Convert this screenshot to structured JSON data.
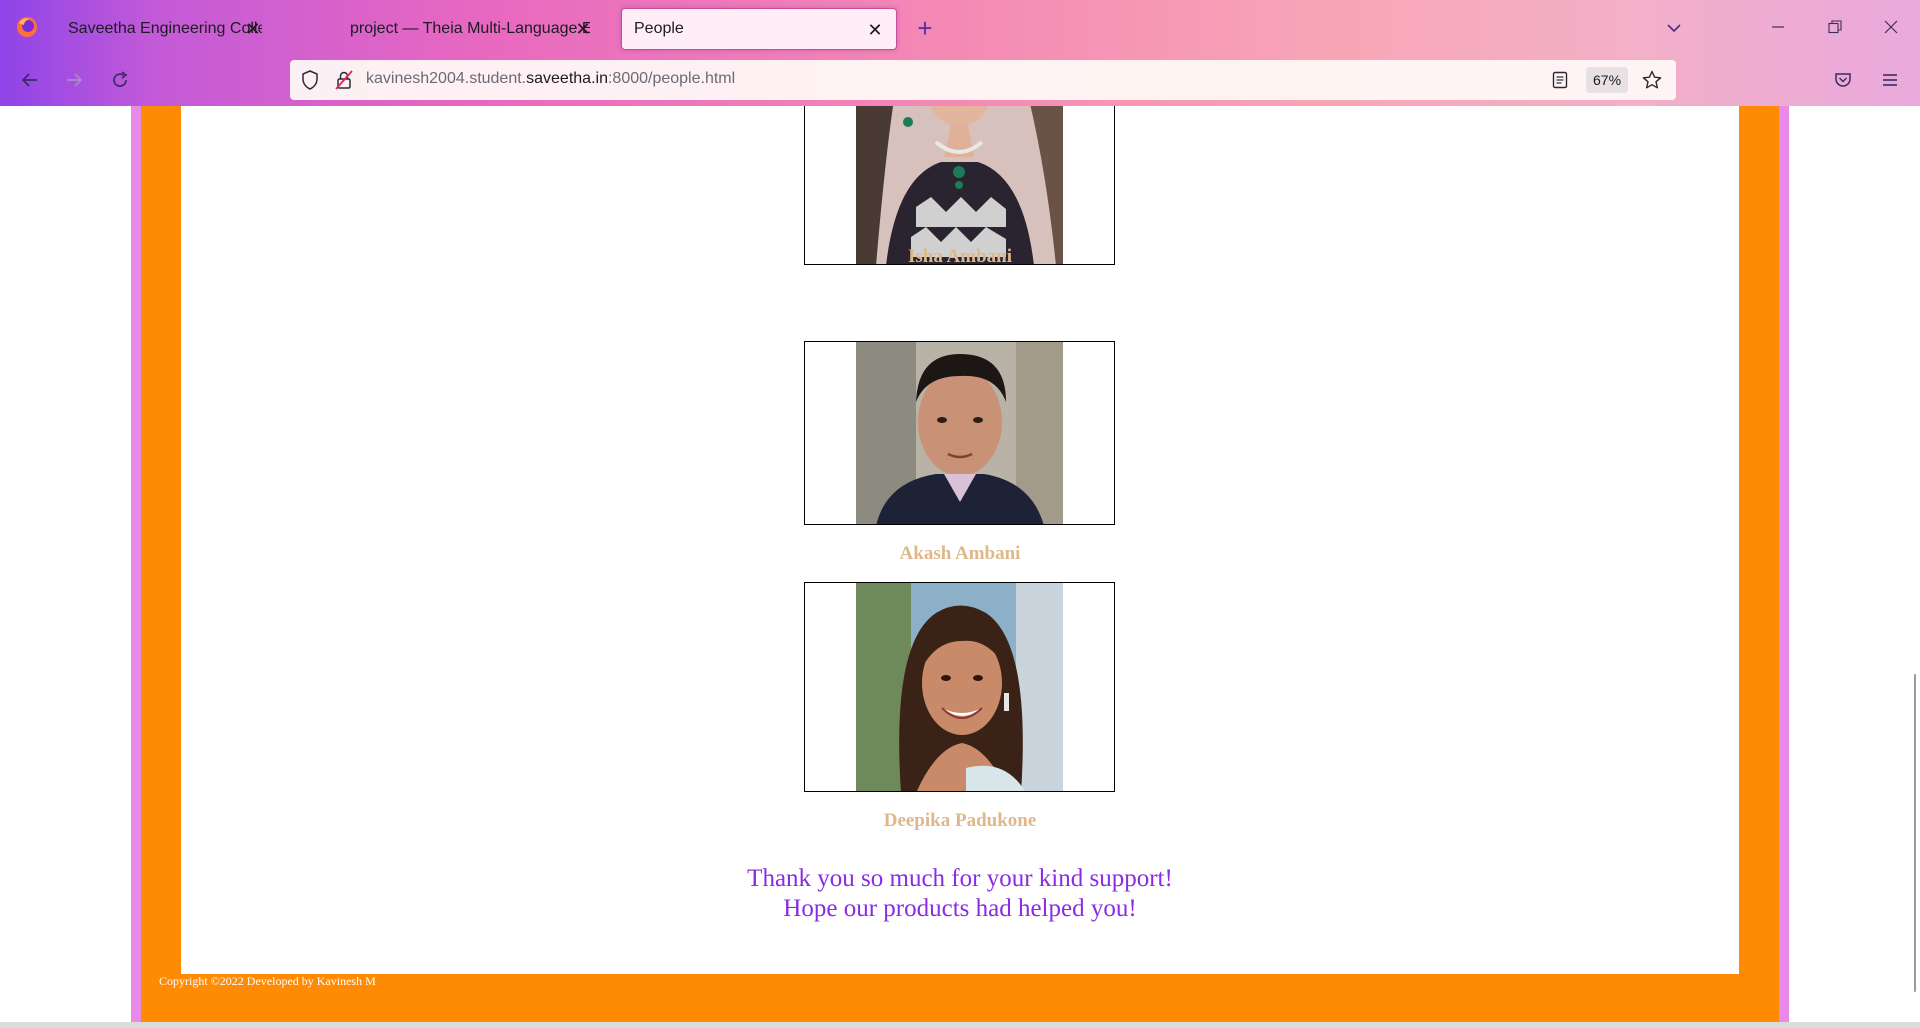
{
  "browser": {
    "tabs": [
      {
        "title": "Saveetha Engineering College",
        "active": false
      },
      {
        "title": "project — Theia Multi-Language Ex",
        "active": false
      },
      {
        "title": "People",
        "active": true
      }
    ],
    "url_prefix": "kavinesh2004.student.",
    "url_host": "saveetha.in",
    "url_suffix": ":8000/people.html",
    "zoom": "67%",
    "close_glyph": "✕",
    "new_tab_glyph": "+"
  },
  "page": {
    "people": [
      {
        "name": "Isha Ambani",
        "photo_icon": "person-photo"
      },
      {
        "name": "Akash Ambani",
        "photo_icon": "person-photo"
      },
      {
        "name": "Deepika Padukone",
        "photo_icon": "person-photo"
      }
    ],
    "thanks_line1": "Thank you so much for your kind support!",
    "thanks_line2": "Hope our products had helped you!",
    "footer": "Copyright ©2022 Developed by Kavinesh M"
  },
  "colors": {
    "frame_outer": "#e88ae8",
    "frame_orange": "#ff8a04",
    "name_color": "#deb88a",
    "thanks_color": "#8a2be2"
  }
}
